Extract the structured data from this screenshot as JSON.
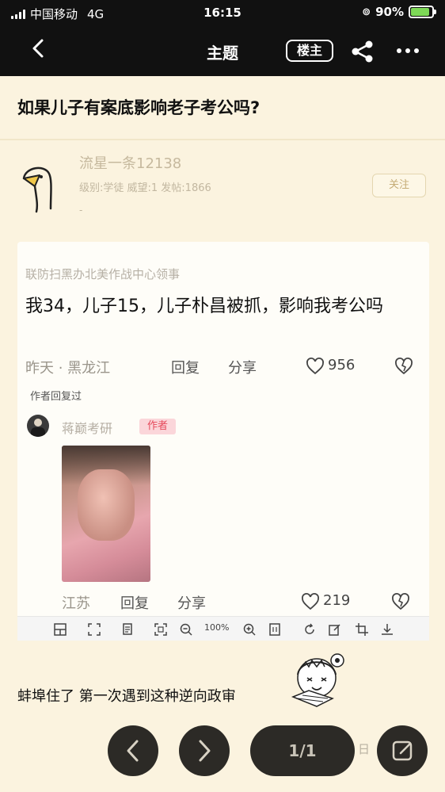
{
  "status_bar": {
    "carrier": "中国移动",
    "network": "4G",
    "time": "16:15",
    "battery": "90%",
    "battery_level": 0.9
  },
  "nav": {
    "title": "主题",
    "louzhu_label": "楼主"
  },
  "thread": {
    "title": "如果儿子有案底影响老子考公吗?"
  },
  "author": {
    "name": "流星一条12138",
    "meta": "级别:学徒 威望:1 发帖:1866",
    "extra": "-",
    "follow_label": "关注"
  },
  "embedded": {
    "quote": "联防扫黑办北美作战中心领事",
    "question": "我34，儿子15，儿子朴昌被抓，影响我考公吗",
    "row1": {
      "time_loc": "昨天 · 黑龙江",
      "reply": "回复",
      "share": "分享",
      "likes": "956"
    },
    "replied_label": "作者回复过",
    "reply_user": "蒋巅考研",
    "author_badge": "作者",
    "row2": {
      "location": "江苏",
      "reply": "回复",
      "share": "分享",
      "likes": "219"
    },
    "toolbar": {
      "zoom": "100%"
    }
  },
  "post": {
    "text": "蚌埠住了 第一次遇到这种逆向政审"
  },
  "bottom": {
    "page": "1/1"
  },
  "icons": [
    "back-icon",
    "share-icon",
    "more-icon",
    "heart-icon",
    "broken-heart-icon",
    "prev-icon",
    "next-icon",
    "edit-icon"
  ]
}
